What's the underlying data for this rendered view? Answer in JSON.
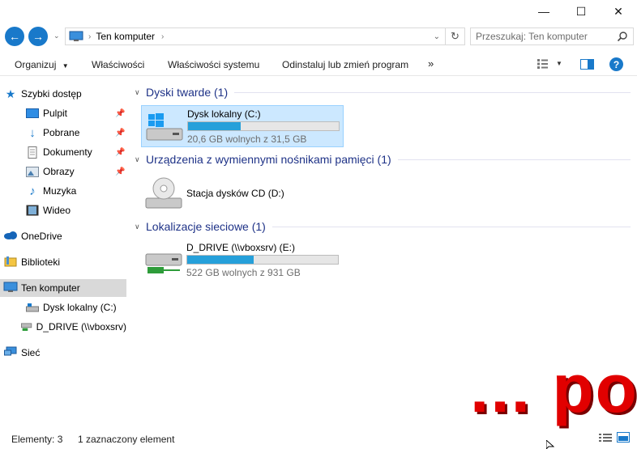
{
  "window": {
    "minimize_glyph": "—",
    "maximize_glyph": "☐",
    "close_glyph": "✕"
  },
  "address": {
    "path": "Ten komputer",
    "search_placeholder": "Przeszukaj: Ten komputer"
  },
  "toolbar": {
    "organize": "Organizuj",
    "properties": "Właściwości",
    "system_properties": "Właściwości systemu",
    "uninstall": "Odinstaluj lub zmień program",
    "more": "»"
  },
  "nav": {
    "quick_access": "Szybki dostęp",
    "desktop": "Pulpit",
    "downloads": "Pobrane",
    "documents": "Dokumenty",
    "pictures": "Obrazy",
    "music": "Muzyka",
    "videos": "Wideo",
    "onedrive": "OneDrive",
    "libraries": "Biblioteki",
    "this_pc": "Ten komputer",
    "local_disk": "Dysk lokalny (C:)",
    "d_drive": "D_DRIVE (\\\\vboxsrv)",
    "network": "Sieć"
  },
  "groups": {
    "hard_drives": "Dyski twarde (1)",
    "removable": "Urządzenia z wymiennymi nośnikami pamięci (1)",
    "network_locations": "Lokalizacje sieciowe (1)"
  },
  "drives": {
    "c": {
      "name": "Dysk lokalny (C:)",
      "free_text": "20,6 GB wolnych z 31,5 GB",
      "used_fraction": 0.35
    },
    "cd": {
      "name": "Stacja dysków CD (D:)"
    },
    "e": {
      "name": "D_DRIVE (\\\\vboxsrv) (E:)",
      "free_text": "522 GB wolnych z 931 GB",
      "used_fraction": 0.44
    }
  },
  "status": {
    "items": "Elementy: 3",
    "selected": "1 zaznaczony element"
  },
  "overlay_text": "... po",
  "colors": {
    "accent": "#1979ca",
    "bar_fill": "#26a0da",
    "group_title": "#1e3287",
    "selection": "#cce8ff",
    "overlay": "#e10000"
  }
}
